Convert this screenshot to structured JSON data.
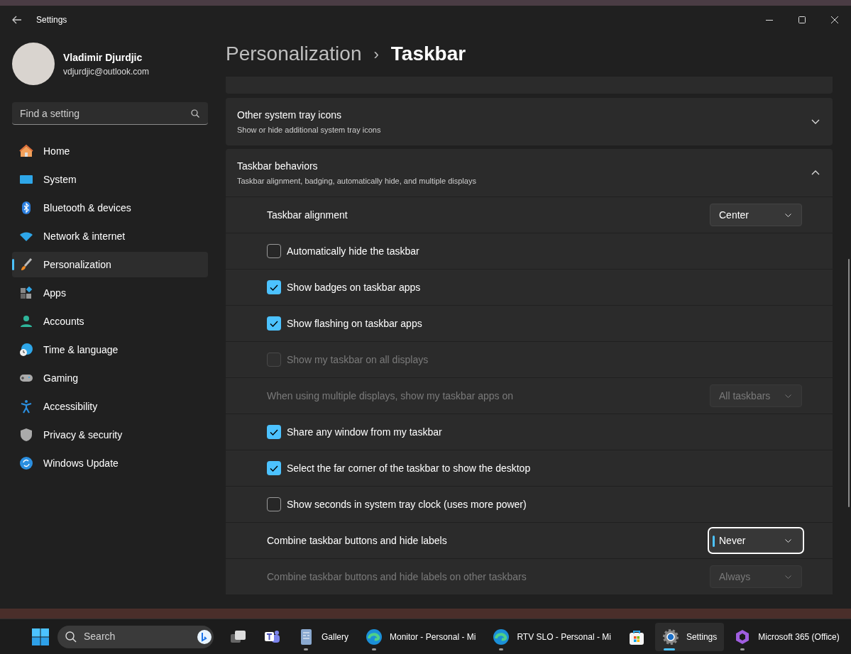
{
  "window": {
    "title": "Settings"
  },
  "account": {
    "name": "Vladimir Djurdjic",
    "email": "vdjurdjic@outlook.com"
  },
  "search": {
    "placeholder": "Find a setting"
  },
  "sidebar": {
    "items": [
      {
        "label": "Home",
        "selected": false
      },
      {
        "label": "System",
        "selected": false
      },
      {
        "label": "Bluetooth & devices",
        "selected": false
      },
      {
        "label": "Network & internet",
        "selected": false
      },
      {
        "label": "Personalization",
        "selected": true
      },
      {
        "label": "Apps",
        "selected": false
      },
      {
        "label": "Accounts",
        "selected": false
      },
      {
        "label": "Time & language",
        "selected": false
      },
      {
        "label": "Gaming",
        "selected": false
      },
      {
        "label": "Accessibility",
        "selected": false
      },
      {
        "label": "Privacy & security",
        "selected": false
      },
      {
        "label": "Windows Update",
        "selected": false
      }
    ]
  },
  "breadcrumb": {
    "parent": "Personalization",
    "separator": "›",
    "current": "Taskbar"
  },
  "sections": [
    {
      "title": "Other system tray icons",
      "subtitle": "Show or hide additional system tray icons",
      "expanded": false
    },
    {
      "title": "Taskbar behaviors",
      "subtitle": "Taskbar alignment, badging, automatically hide, and multiple displays",
      "expanded": true
    }
  ],
  "rows": [
    {
      "kind": "dropdown",
      "label": "Taskbar alignment",
      "value": "Center",
      "disabled": false,
      "focused": false
    },
    {
      "kind": "checkbox",
      "label": "Automatically hide the taskbar",
      "checked": false,
      "disabled": false
    },
    {
      "kind": "checkbox",
      "label": "Show badges on taskbar apps",
      "checked": true,
      "disabled": false
    },
    {
      "kind": "checkbox",
      "label": "Show flashing on taskbar apps",
      "checked": true,
      "disabled": false
    },
    {
      "kind": "checkbox",
      "label": "Show my taskbar on all displays",
      "checked": false,
      "disabled": true
    },
    {
      "kind": "dropdown",
      "label": "When using multiple displays, show my taskbar apps on",
      "value": "All taskbars",
      "disabled": true,
      "focused": false
    },
    {
      "kind": "checkbox",
      "label": "Share any window from my taskbar",
      "checked": true,
      "disabled": false
    },
    {
      "kind": "checkbox",
      "label": "Select the far corner of the taskbar to show the desktop",
      "checked": true,
      "disabled": false
    },
    {
      "kind": "checkbox",
      "label": "Show seconds in system tray clock (uses more power)",
      "checked": false,
      "disabled": false
    },
    {
      "kind": "dropdown",
      "label": "Combine taskbar buttons and hide labels",
      "value": "Never",
      "disabled": false,
      "focused": true
    },
    {
      "kind": "dropdown",
      "label": "Combine taskbar buttons and hide labels on other taskbars",
      "value": "Always",
      "disabled": true,
      "focused": false
    }
  ],
  "taskbar": {
    "search_placeholder": "Search",
    "items": [
      {
        "kind": "taskview",
        "running": false,
        "selected": false
      },
      {
        "kind": "teams",
        "running": false,
        "selected": false
      },
      {
        "kind": "gallery",
        "label": "Gallery",
        "running": true,
        "selected": false
      },
      {
        "kind": "edge",
        "label": "Monitor - Personal - Mi",
        "running": true,
        "selected": false
      },
      {
        "kind": "edge",
        "label": "RTV SLO - Personal - Mi",
        "running": true,
        "selected": false
      },
      {
        "kind": "store",
        "running": false,
        "selected": false
      },
      {
        "kind": "settings",
        "label": "Settings",
        "running": true,
        "selected": true
      },
      {
        "kind": "office",
        "label": "Microsoft 365 (Office)",
        "running": true,
        "selected": false
      }
    ]
  }
}
